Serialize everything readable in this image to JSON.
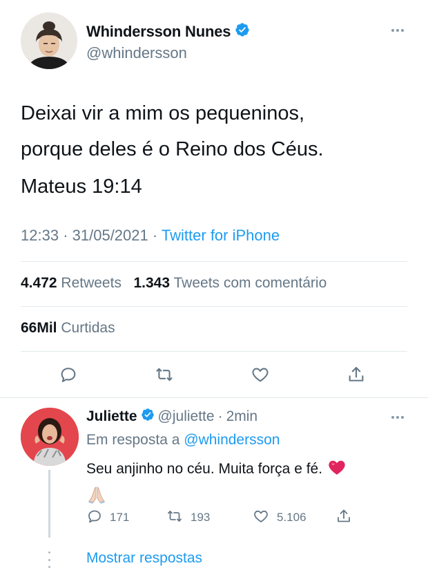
{
  "author": {
    "name": "Whindersson Nunes",
    "handle": "@whindersson"
  },
  "tweet": {
    "line1": "Deixai vir a mim os pequeninos,",
    "line2": "porque deles é o Reino dos Céus.",
    "reference": "Mateus 19:14",
    "time": "12:33",
    "date_sep": "·",
    "date": "31/05/2021",
    "source_sep": "·",
    "source": "Twitter for iPhone"
  },
  "stats": {
    "retweets_count": "4.472",
    "retweets_label": "Retweets",
    "quotes_count": "1.343",
    "quotes_label": "Tweets com comentário",
    "likes_count": "66Mil",
    "likes_label": "Curtidas"
  },
  "actions": [
    "reply-icon",
    "retweet-icon",
    "like-icon",
    "share-icon"
  ],
  "reply": {
    "name": "Juliette",
    "handle": "@juliette",
    "sep": "·",
    "time": "2min",
    "in_reply_prefix": "Em resposta a",
    "in_reply_handle": "@whindersson",
    "text": "Seu anjinho no céu. Muita força e fé.",
    "emoji_heart": "❤️",
    "emoji_hands": "🙏🏻",
    "reply_count": "171",
    "retweet_count": "193",
    "like_count": "5.106"
  },
  "show_replies": "Mostrar respostas",
  "colors": {
    "accent": "#1d9bf0",
    "muted": "#657786",
    "divider": "#e1e8ed",
    "heart": "#e0245e"
  }
}
